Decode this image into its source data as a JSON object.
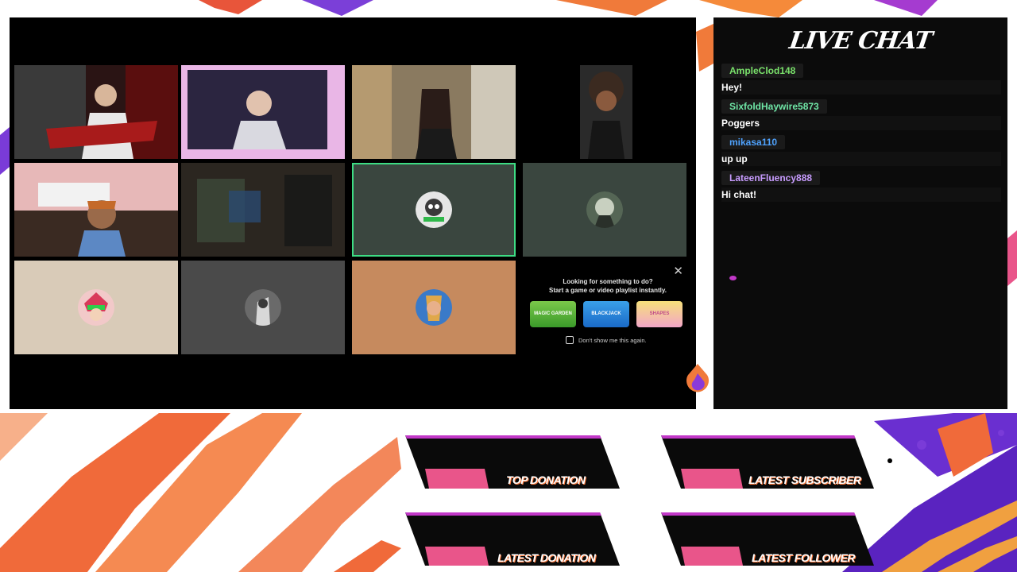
{
  "chat": {
    "title": "LIVE CHAT",
    "messages": [
      {
        "user": "AmpleClod148",
        "text": "Hey!",
        "color": "#79e06a"
      },
      {
        "user": "SixfoldHaywire5873",
        "text": "Poggers",
        "color": "#6fe6a6"
      },
      {
        "user": "mikasa110",
        "text": "up up",
        "color": "#4fa3ff"
      },
      {
        "user": "LateenFluency888",
        "text": "Hi chat!",
        "color": "#c89cff"
      }
    ]
  },
  "suggestion": {
    "close_glyph": "✕",
    "line1": "Looking for something to do?",
    "line2": "Start a game or video playlist instantly.",
    "games": [
      {
        "name": "MAGIC GARDEN"
      },
      {
        "name": "BLACKJACK"
      },
      {
        "name": "SHAPES"
      }
    ],
    "dont_show": "Don't show me this again."
  },
  "banners": {
    "top_donation": "TOP DONATION",
    "latest_subscriber": "LATEST SUBSCRIBER",
    "latest_donation": "LATEST DONATION",
    "latest_follower": "LATEST FOLLOWER"
  },
  "colors": {
    "speaking_outline": "#3ddc84",
    "accent_orange": "#f06a3a",
    "accent_purple": "#6a2fd0",
    "accent_pink": "#c238c8"
  }
}
